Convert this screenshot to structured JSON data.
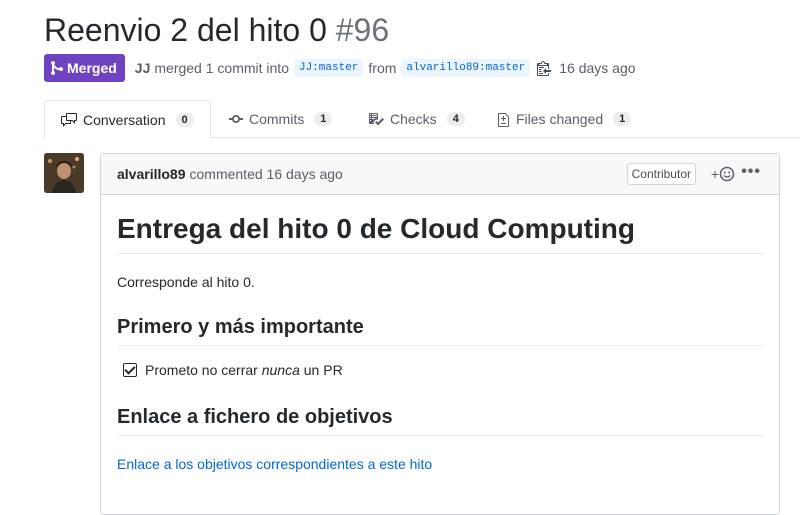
{
  "pr": {
    "title": "Reenvio 2 del hito 0",
    "number": "#96"
  },
  "meta": {
    "status": "Merged",
    "author": "JJ",
    "text1": "merged 1 commit into",
    "base_branch": "JJ:master",
    "text2": "from",
    "head_branch": "alvarillo89:master",
    "time": "16 days ago"
  },
  "tabs": [
    {
      "label": "Conversation",
      "count": "0",
      "icon": "comment-discussion-icon"
    },
    {
      "label": "Commits",
      "count": "1",
      "icon": "commit-icon"
    },
    {
      "label": "Checks",
      "count": "4",
      "icon": "checklist-icon"
    },
    {
      "label": "Files changed",
      "count": "1",
      "icon": "file-diff-icon"
    }
  ],
  "comment": {
    "user": "alvarillo89",
    "action": "commented 16 days ago",
    "role": "Contributor",
    "react_label": "+",
    "menu": "•••"
  },
  "body": {
    "h1": "Entrega del hito 0 de Cloud Computing",
    "p1": "Corresponde al hito 0.",
    "h2a": "Primero y más importante",
    "task_pre": "Prometo no cerrar ",
    "task_em": "nunca",
    "task_post": " un PR",
    "h2b": "Enlace a fichero de objetivos",
    "link": "Enlace a los objetivos correspondientes a este hito"
  },
  "colors": {
    "merged": "#6f42c1",
    "link": "#0366d6"
  }
}
